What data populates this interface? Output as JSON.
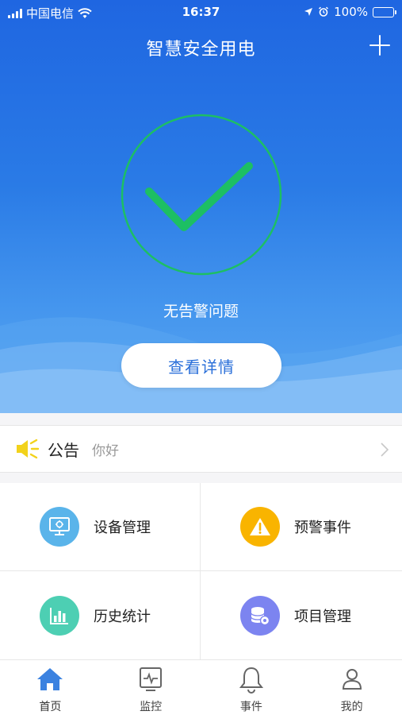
{
  "status_bar": {
    "carrier": "中国电信",
    "time": "16:37",
    "battery": "100%"
  },
  "header": {
    "title": "智慧安全用电"
  },
  "hero": {
    "status_text": "无告警问题",
    "detail_button": "查看详情"
  },
  "notice": {
    "label": "公告",
    "message": "你好"
  },
  "grid": {
    "items": [
      {
        "label": "设备管理",
        "icon": "monitor-icon",
        "color": "#5ab4ea"
      },
      {
        "label": "预警事件",
        "icon": "warning-icon",
        "color": "#f9b400"
      },
      {
        "label": "历史统计",
        "icon": "bar-chart-icon",
        "color": "#4dcfb3"
      },
      {
        "label": "项目管理",
        "icon": "database-gear-icon",
        "color": "#7c84f0"
      }
    ]
  },
  "tabbar": {
    "items": [
      {
        "label": "首页",
        "icon": "home-icon",
        "active": true
      },
      {
        "label": "监控",
        "icon": "monitor-pulse-icon",
        "active": false
      },
      {
        "label": "事件",
        "icon": "bell-icon",
        "active": false
      },
      {
        "label": "我的",
        "icon": "user-icon",
        "active": false
      }
    ]
  },
  "colors": {
    "primary": "#2a6fd9",
    "check_green": "#1dbf63",
    "active_tab": "#3b82e0"
  }
}
